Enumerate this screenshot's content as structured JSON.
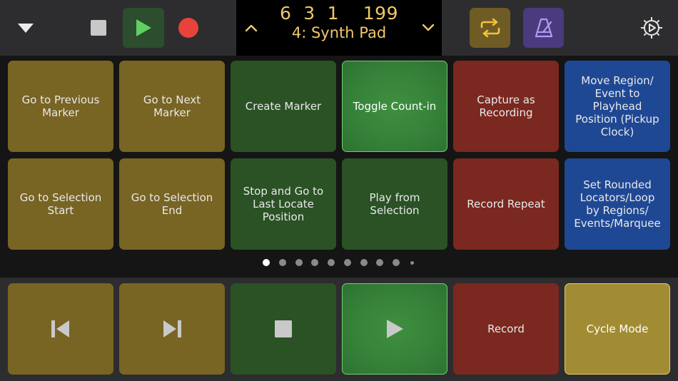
{
  "transport": {
    "position": "6  3  1    199",
    "track": "4: Synth Pad"
  },
  "grid": {
    "rows": [
      [
        {
          "label": "Go to Previous Marker",
          "color": "yellow"
        },
        {
          "label": "Go to Next Marker",
          "color": "yellow"
        },
        {
          "label": "Create Marker",
          "color": "green"
        },
        {
          "label": "Toggle Count-in",
          "color": "green-on"
        },
        {
          "label": "Capture as Recording",
          "color": "red"
        },
        {
          "label": "Move Region/ Event to Playhead Position (Pickup Clock)",
          "color": "blue"
        }
      ],
      [
        {
          "label": "Go to Selection Start",
          "color": "yellow"
        },
        {
          "label": "Go to Selection End",
          "color": "yellow"
        },
        {
          "label": "Stop and Go to Last Locate Position",
          "color": "green"
        },
        {
          "label": "Play from Selection",
          "color": "green"
        },
        {
          "label": "Record Repeat",
          "color": "red"
        },
        {
          "label": "Set Rounded Locators/Loop by Regions/ Events/Marquee",
          "color": "blue"
        }
      ]
    ]
  },
  "page_indicator": {
    "count": 10,
    "active_index": 0
  },
  "bottom": {
    "record_label": "Record",
    "cycle_label": "Cycle Mode"
  },
  "colors": {
    "yellow": "#786423",
    "green": "#2a5225",
    "red": "#7a2820",
    "blue": "#1f4894",
    "lcd_text": "#efc86a",
    "play_icon": "#5fcf5f",
    "record_icon": "#e8433a"
  },
  "icons": {
    "top": [
      "chevron-down-icon",
      "stop-icon",
      "play-icon",
      "record-icon",
      "chevron-up-icon",
      "chevron-down-icon",
      "cycle-icon",
      "metronome-icon",
      "gear-icon"
    ],
    "bottom": [
      "skip-back-icon",
      "skip-forward-icon",
      "stop-icon",
      "play-icon"
    ]
  }
}
